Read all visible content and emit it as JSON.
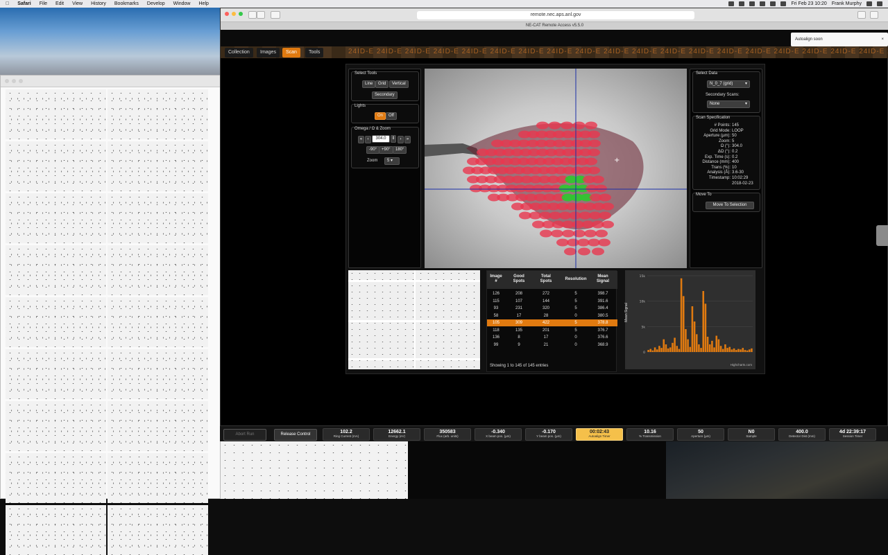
{
  "menubar": {
    "app": "Safari",
    "items": [
      "File",
      "Edit",
      "View",
      "History",
      "Bookmarks",
      "Develop",
      "Window",
      "Help"
    ],
    "clock": "Fri Feb 23  10:20",
    "user": "Frank Murphy"
  },
  "browser": {
    "url": "remote.nec.aps.anl.gov",
    "tab_title": "NE-CAT Remote Access v5.5.0"
  },
  "notification": "Autoalign soon",
  "nav": {
    "tabs": [
      "Collection",
      "Images",
      "Scan",
      "Tools"
    ],
    "active": "Scan",
    "beamline_watermark": "24ID-E 24ID-E 24ID-E 24ID-E 24ID-E 24ID-E 24ID-E 24ID-E 24ID-E 24ID-E 24ID-E 24ID-E 24ID-E 24ID-E 24ID-E 24ID-E 24ID-E 24ID-E 24ID-E 24ID-E 24ID-E 24ID-E"
  },
  "select_tools": {
    "title": "Select Tools",
    "buttons": [
      "Line",
      "Grid",
      "Vertical"
    ],
    "secondary": "Secondary"
  },
  "lights": {
    "title": "Lights",
    "on": "On",
    "off": "Off"
  },
  "omega": {
    "title": "Omega / Ω & Zoom",
    "value": "304.0",
    "rot_buttons": [
      "-90°",
      "+90°",
      "180°"
    ],
    "zoom_label": "Zoom",
    "zoom_value": "5"
  },
  "select_data": {
    "title": "Select Data",
    "dataset": "N_0_7 (grid)",
    "secondary_label": "Secondary Scans:",
    "secondary_value": "None"
  },
  "scan_spec": {
    "title": "Scan Specification",
    "rows": [
      {
        "k": "# Points:",
        "v": "145"
      },
      {
        "k": "Grid Mode:",
        "v": "LOOP"
      },
      {
        "k": "Aperture (µm):",
        "v": "50"
      },
      {
        "k": "Zoom:",
        "v": "5"
      },
      {
        "k": "Ω (°):",
        "v": "304.0"
      },
      {
        "k": "ΔΩ (°):",
        "v": "0.2"
      },
      {
        "k": "Exp. Time (s):",
        "v": "0.2"
      },
      {
        "k": "Distance (mm):",
        "v": "400"
      },
      {
        "k": "Trans (%):",
        "v": "10"
      },
      {
        "k": "Analysis (Å):",
        "v": "3.6-30"
      },
      {
        "k": "Timestamp:",
        "v": "10:02:29"
      },
      {
        "k": "",
        "v": "2018-02-23"
      }
    ]
  },
  "move_to": {
    "title": "Move To",
    "button": "Move To Selection"
  },
  "table": {
    "headers": [
      "Image #",
      "Good Spots",
      "Total Spots",
      "Resolution",
      "Mean Signal"
    ],
    "rows": [
      [
        "126",
        "208",
        "272",
        "5",
        "398.7"
      ],
      [
        "115",
        "107",
        "144",
        "5",
        "391.6"
      ],
      [
        "93",
        "231",
        "320",
        "5",
        "386.4"
      ],
      [
        "58",
        "17",
        "28",
        "0",
        "380.5"
      ],
      [
        "105",
        "309",
        "422",
        "5",
        "378.8"
      ],
      [
        "118",
        "135",
        "201",
        "5",
        "376.7"
      ],
      [
        "136",
        "8",
        "17",
        "0",
        "376.6"
      ],
      [
        "99",
        "9",
        "21",
        "0",
        "368.9"
      ]
    ],
    "selected_index": 4,
    "footer": "Showing 1 to 145 of 145 entries"
  },
  "chart_data": {
    "type": "bar",
    "ylabel": "Mean Signal",
    "yticks": [
      "15k",
      "10k",
      "5k",
      "0"
    ],
    "ylim": [
      0,
      15000
    ],
    "credit": "Highcharts.com",
    "values": [
      400,
      600,
      300,
      900,
      500,
      1200,
      800,
      2500,
      1500,
      700,
      900,
      1800,
      2800,
      1200,
      600,
      14500,
      11000,
      4500,
      2500,
      1000,
      9000,
      6000,
      3500,
      1500,
      800,
      12000,
      9500,
      3000,
      1500,
      2200,
      900,
      3200,
      2500,
      1200,
      600,
      1500,
      800,
      1000,
      500,
      700,
      400,
      600,
      500,
      800,
      400,
      300,
      500,
      700
    ]
  },
  "status": {
    "abort": "Abort Run",
    "release": "Release Control",
    "items": [
      {
        "v": "102.2",
        "k": "Ring Current (mA)"
      },
      {
        "v": "12662.1",
        "k": "Energy (eV)"
      },
      {
        "v": "350583",
        "k": "Flux (arb. units)"
      },
      {
        "v": "-0.340",
        "k": "X beam pos. (µm)"
      },
      {
        "v": "-0.170",
        "k": "Y beam pos. (µm)"
      },
      {
        "v": "00:02:43",
        "k": "Autoalign Timer"
      },
      {
        "v": "10.16",
        "k": "% Transmission"
      },
      {
        "v": "50",
        "k": "Aperture (µm)"
      },
      {
        "v": "N0",
        "k": "Sample"
      },
      {
        "v": "400.0",
        "k": "Detector Dist (mm)"
      },
      {
        "v": "4d 22:39:17",
        "k": "Session Timer"
      }
    ],
    "highlight_index": 5
  },
  "colors": {
    "accent": "#e07a10",
    "highlight": "#f5c04a",
    "grid_red": "#e8374f",
    "grid_green": "#2ec82e"
  }
}
